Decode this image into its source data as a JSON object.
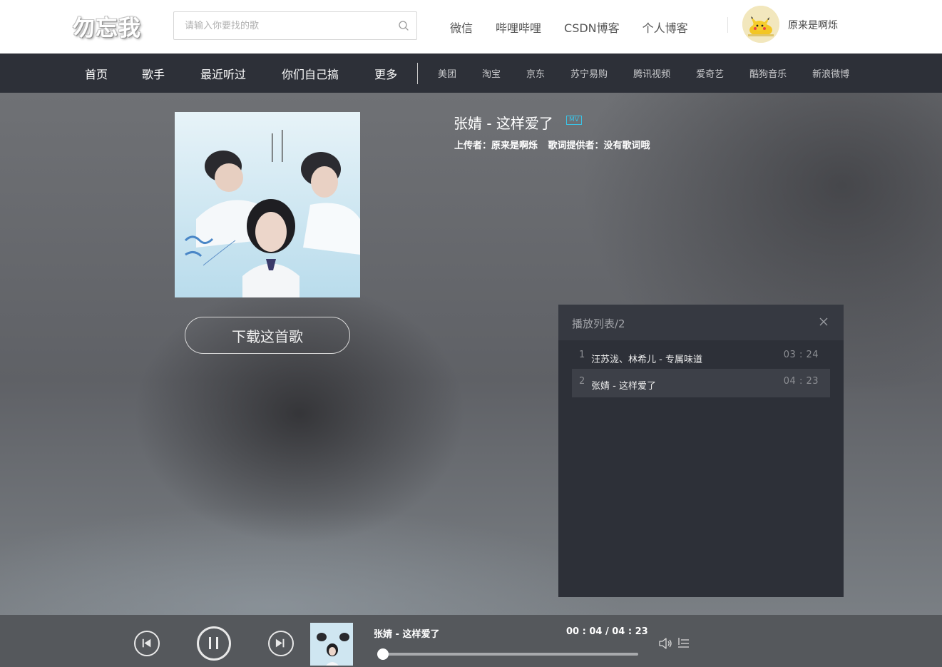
{
  "header": {
    "logo": "勿忘我",
    "search_placeholder": "请输入你要找的歌",
    "links": [
      "微信",
      "哔哩哔哩",
      "CSDN博客",
      "个人博客"
    ],
    "username": "原来是啊烁"
  },
  "nav": {
    "main": [
      "首页",
      "歌手",
      "最近听过",
      "你们自己搞",
      "更多"
    ],
    "sub": [
      "美团",
      "淘宝",
      "京东",
      "苏宁易购",
      "腾讯视频",
      "爱奇艺",
      "酷狗音乐",
      "新浪微博"
    ]
  },
  "song": {
    "title": "张婧 - 这样爱了",
    "mv_badge": "MV",
    "uploader": "上传者：原来是啊烁",
    "lyrics_provider": "歌词提供者：没有歌词哦",
    "download_label": "下载这首歌"
  },
  "playlist": {
    "title": "播放列表/2",
    "items": [
      {
        "num": "1",
        "name": "汪苏泷、林希儿 - 专属味道",
        "duration": "03 : 24",
        "active": false
      },
      {
        "num": "2",
        "name": "张婧 - 这样爱了",
        "duration": "04 : 23",
        "active": true
      }
    ]
  },
  "player": {
    "now_title": "张婧 - 这样爱了",
    "time": "00 : 04 / 04 : 23",
    "progress": 0.015
  },
  "icons": {
    "search": "search-icon",
    "close": "close-icon",
    "prev": "skip-previous-icon",
    "pause": "pause-icon",
    "next": "skip-next-icon",
    "volume": "volume-icon",
    "playlist": "playlist-icon"
  },
  "colors": {
    "nav_bg": "#2d3038",
    "panel_bg": "#2d3038",
    "accent_mv": "#3bc3e6"
  }
}
